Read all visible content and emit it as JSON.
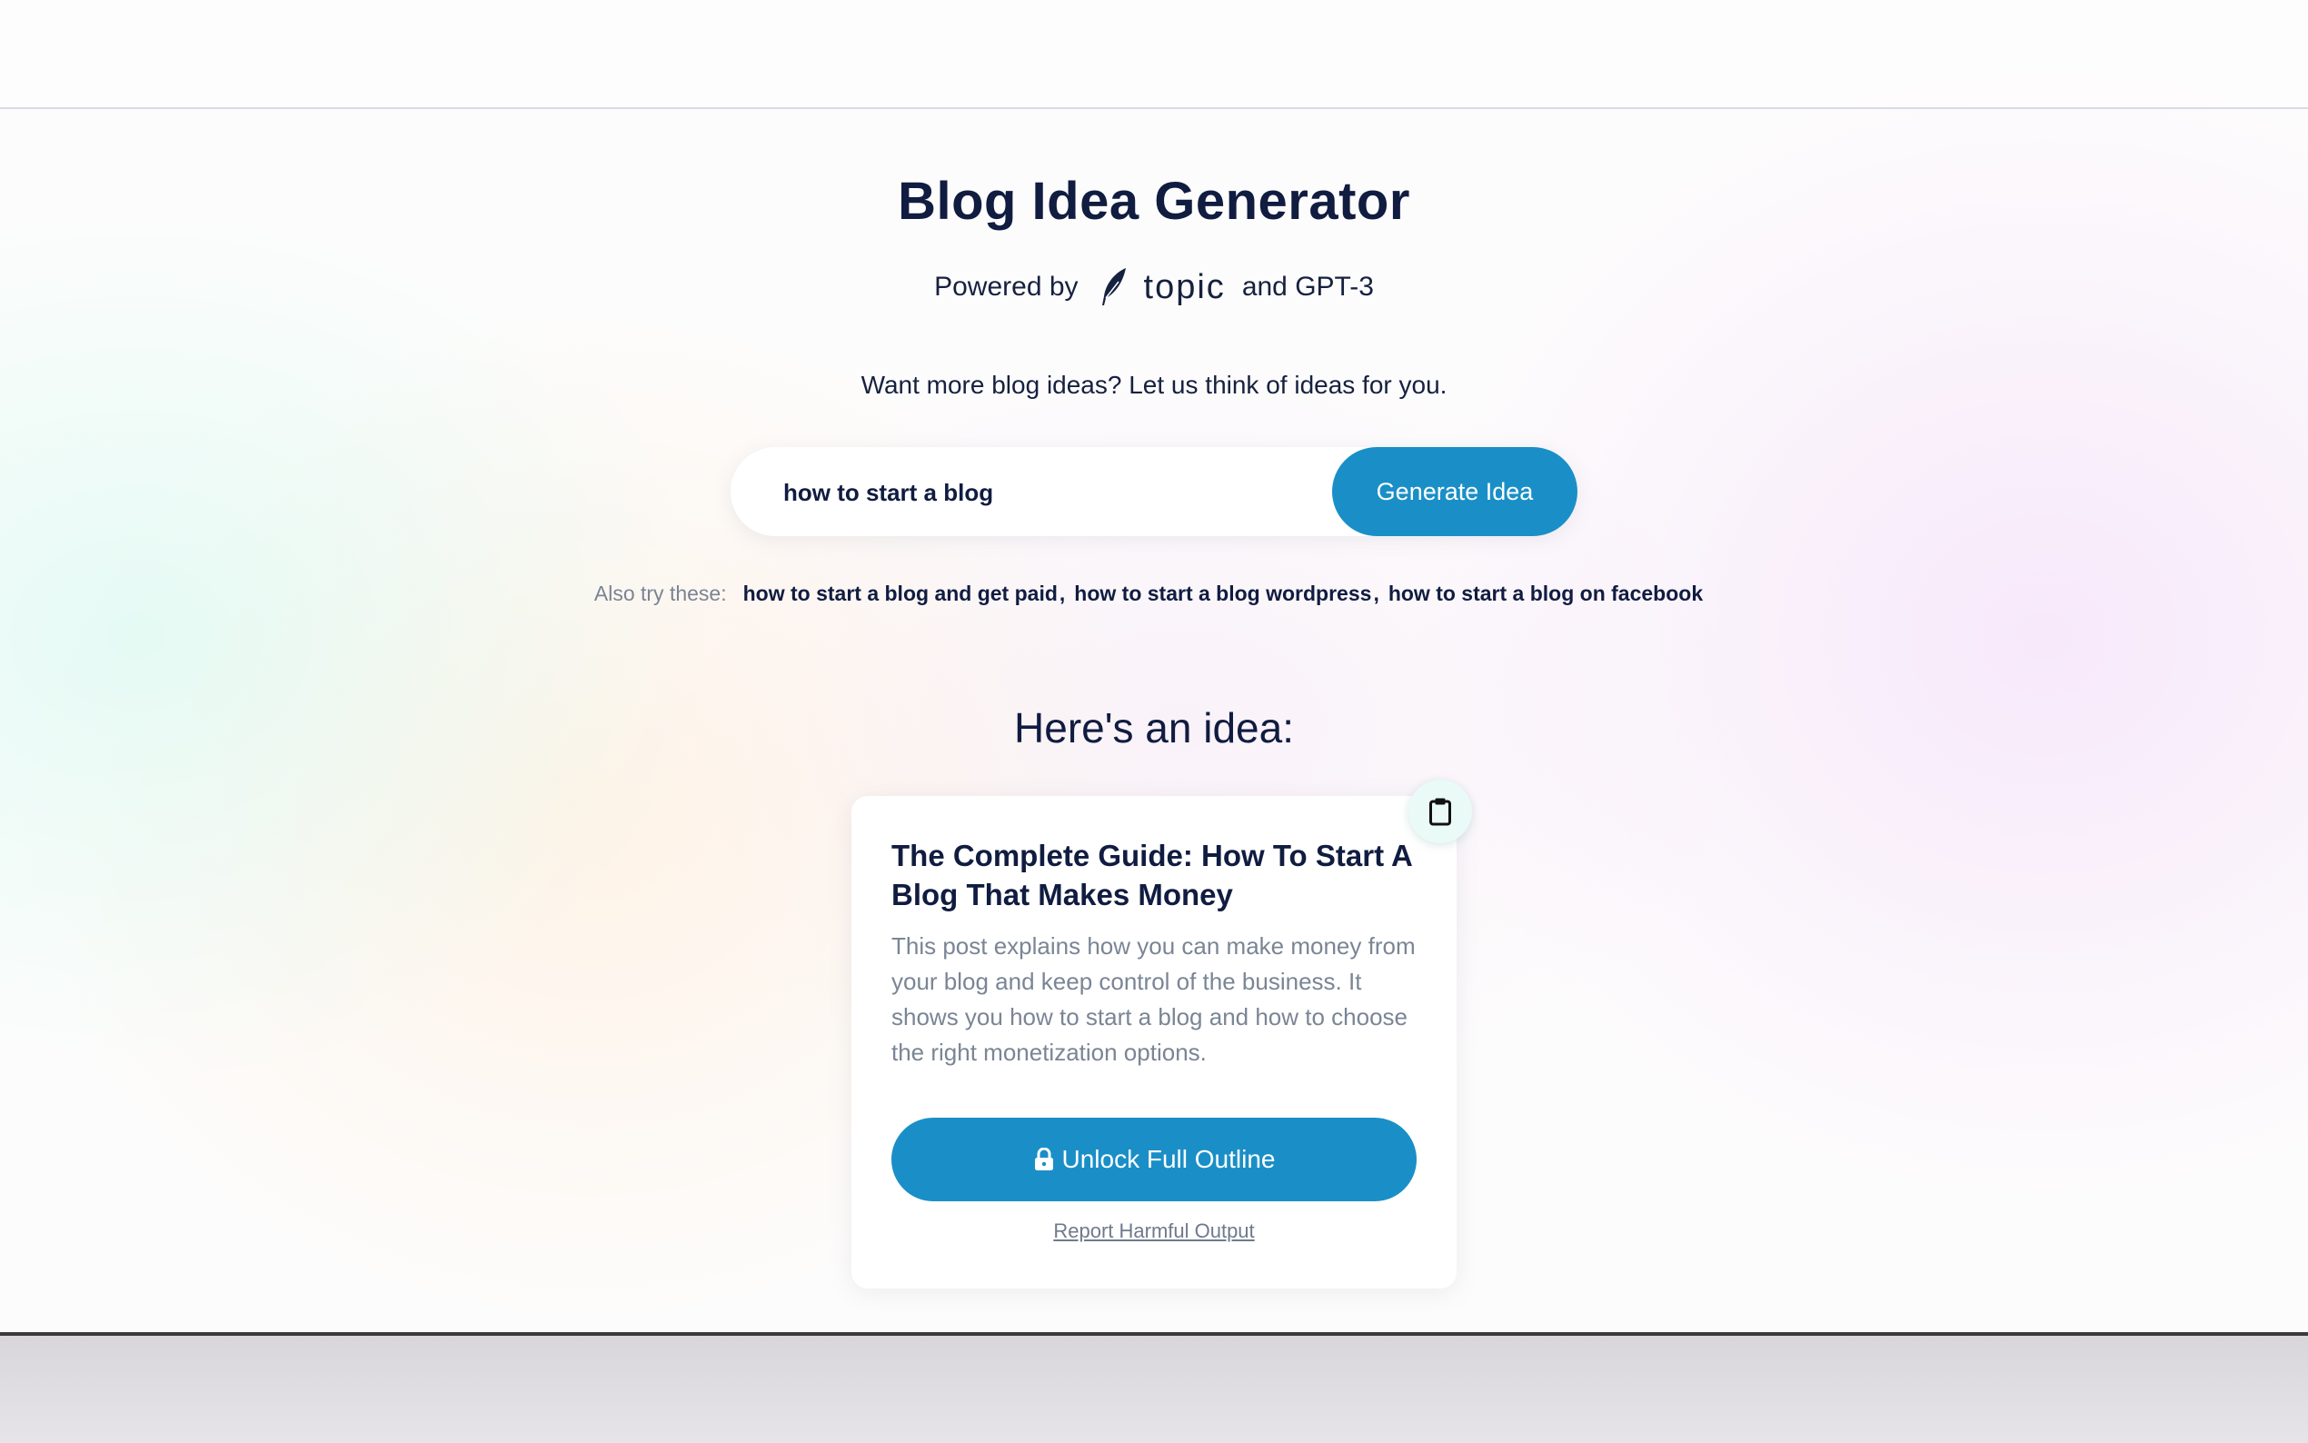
{
  "header": {
    "title": "Blog Idea Generator",
    "powered_prefix": "Powered by",
    "brand_name": "topic",
    "powered_suffix": "and GPT-3",
    "brand_icon": "feather-icon"
  },
  "intro": {
    "tagline": "Want more blog ideas? Let us think of ideas for you."
  },
  "search": {
    "value": "how to start a blog",
    "button_label": "Generate Idea"
  },
  "suggestions": {
    "label": "Also try these:",
    "items": [
      "how to start a blog and get paid",
      "how to start a blog wordpress",
      "how to start a blog on facebook"
    ]
  },
  "result": {
    "heading": "Here's an idea:",
    "copy_icon": "clipboard-icon",
    "title": "The Complete Guide: How To Start A Blog That Makes Money",
    "description": "This post explains how you can make money from your blog and keep control of the business. It shows you how to start a blog and how to choose the right monetization options.",
    "unlock_label": "Unlock Full Outline",
    "unlock_icon": "lock-icon",
    "report_label": "Report Harmful Output"
  },
  "colors": {
    "primary": "#1a8fc7",
    "text_dark": "#101c40",
    "text_muted": "#7a8595",
    "copy_button_bg": "#eafaf6"
  }
}
